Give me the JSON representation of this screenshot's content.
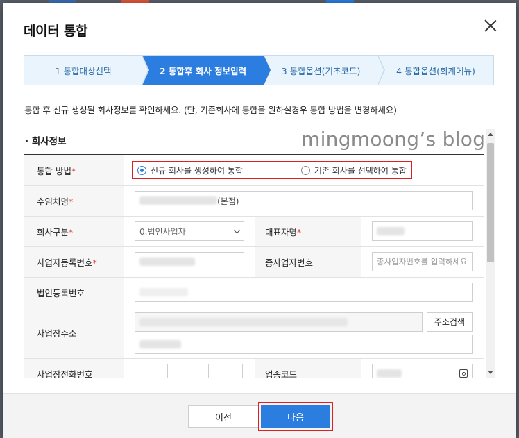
{
  "dialog": {
    "title": "데이터 통합"
  },
  "steps": [
    {
      "label": "1 통합대상선택"
    },
    {
      "label": "2 통합후 회사 정보입력"
    },
    {
      "label": "3 통합옵션(기초코드)"
    },
    {
      "label": "4 통합옵션(회계메뉴)"
    }
  ],
  "notice": "통합 후 신규 생성될 회사정보를 확인하세요. (단, 기존회사에 통합을 원하실경우 통합 방법을 변경하세요)",
  "section_title": "· 회사정보",
  "watermark": "mingmoong’s blog",
  "form": {
    "merge_method_label": "통합 방법",
    "merge_option_new": "신규 회사를 생성하여 통합",
    "merge_option_existing": "기존 회사를 선택하여 통합",
    "trustee_label": "수임처명",
    "trustee_suffix": "(본점)",
    "company_type_label": "회사구분",
    "company_type_value": "0.법인사업자",
    "ceo_label": "대표자명",
    "biz_no_label": "사업자등록번호",
    "sub_biz_no_label": "종사업자번호",
    "sub_biz_no_placeholder": "종사업자번호를 입력하세요",
    "corp_no_label": "법인등록번호",
    "address_label": "사업장주소",
    "address_search_button": "주소검색",
    "phone_label": "사업장전화번호",
    "industry_code_label": "업종코드",
    "required_mark": "*"
  },
  "footer": {
    "prev_label": "이전",
    "next_label": "다음"
  },
  "colors": {
    "accent": "#2b7de0",
    "highlight_border": "#e02020"
  }
}
